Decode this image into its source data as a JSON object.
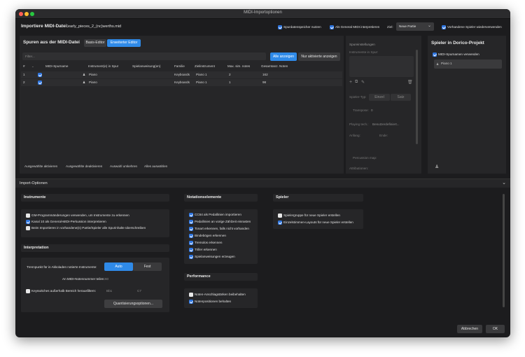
{
  "window": {
    "title": "MIDI-Importoptionen"
  },
  "top": {
    "file_label": "Importiere MIDI-Datei:",
    "file_name": "early_pieces_2_(nc)werths.mid",
    "opt_save_tracks": "Spurdatenspeicher nutzen",
    "opt_gm": "Als General MIDI interpretieren",
    "target_label": "Ziel:",
    "target_value": "Neue Partie",
    "opt_reuse_players": "Vorhandene Spieler wiederverwenden"
  },
  "tracks": {
    "title": "Spuren aus der MIDI-Datei",
    "mode_basic": "Basis-Editor",
    "mode_advanced": "Erweiterter Editor",
    "filter_placeholder": "Filter...",
    "show_all": "Alle anzeigen",
    "show_active": "Nur aktivierte anzeigen",
    "columns": [
      "#",
      "MIDI-Spurname",
      "Instrument(e) in Spur",
      "Spielanweisung(en)",
      "Familie",
      "Zielinstrument",
      "Max. sim. notes",
      "Gesamtanz. Noten"
    ],
    "rows": [
      {
        "num": "1",
        "instrument": "Piano",
        "family": "Keyboards",
        "target": "Piano 1",
        "max": "2",
        "total": "162"
      },
      {
        "num": "2",
        "instrument": "Piano",
        "family": "Keyboards",
        "target": "Piano 1",
        "max": "1",
        "total": "98"
      }
    ],
    "actions": [
      "Ausgewählte aktivieren",
      "Ausgewählte deaktivieren",
      "Auswahl umkehren",
      "Alles auswählen"
    ]
  },
  "track_settings": {
    "title": "Spureinstellungen",
    "instruments_label": "Instrumente in Spur:",
    "player_type_label": "Spieler-Typ:",
    "player_solo": "Einzel",
    "player_section": "Satz",
    "transpose_label": "Transpose:",
    "transpose_value": "0",
    "playing_tech_label": "Playing tech.:",
    "playing_tech_value": "Benutzerdefiniert...",
    "start_label": "Anfang:",
    "end_label": "Ende:",
    "percussion_label": "Percussion map:",
    "attributes_label": "Attributionen:"
  },
  "players": {
    "title": "Spieler in Dorico-Projekt",
    "use_midi_names": "MIDI-Spurnamen verwenden",
    "player_item": "Piano 1"
  },
  "import_options": {
    "title": "Import-Optionen",
    "instruments": {
      "title": "Instrumente",
      "items": [
        {
          "label": "GM-Programmänderungen verwenden, um Instrumente zu erkennen",
          "checked": false
        },
        {
          "label": "Kanal 10 als General-MIDI-Perkussion interpretieren",
          "checked": true
        },
        {
          "label": "Beim Importieren in vorhandene(n) Partie/Spieler alle Spurinhalte überschreiben",
          "checked": false
        }
      ]
    },
    "interpretation": {
      "title": "Interpretation",
      "split_label": "Trennpunkt für in Akkoladen notierte Instrumente:",
      "split_auto": "Auto",
      "split_fixed": "Fest",
      "midi_note_label": "An MIDI-Notennummer teilen:",
      "midi_note_value": "60",
      "keyswitch_label": "Keyswitches außerhalb Bereich herausfiltern:",
      "keyswitch_low": "Bb1",
      "keyswitch_high": "C7",
      "quantize_button": "Quantisierungsoptionen..."
    },
    "notation": {
      "title": "Notationselemente",
      "items": [
        {
          "label": "CC64 als Pedallinien importieren",
          "checked": true
        },
        {
          "label": "Pedallinien an vorige Zählzeit einrasten",
          "checked": true
        },
        {
          "label": "Tonart erkennen, falls nicht vorhanden",
          "checked": true
        },
        {
          "label": "Bindebögen erkennen",
          "checked": true
        },
        {
          "label": "Tremolos erkennen",
          "checked": true
        },
        {
          "label": "Triller erkennen",
          "checked": true
        },
        {
          "label": "Spielanweisungen erzeugen",
          "checked": true
        }
      ]
    },
    "performance": {
      "title": "Performance",
      "items": [
        {
          "label": "Noten-Anschlagstärken beibehalten",
          "checked": false
        },
        {
          "label": "Notenpositionen behalten",
          "checked": true
        }
      ]
    },
    "players": {
      "title": "Spieler",
      "items": [
        {
          "label": "Spielergruppe für neue Spieler erstellen",
          "checked": false
        },
        {
          "label": "Einzelstimmen-Layouts für neue Spieler erstellen",
          "checked": true
        }
      ]
    }
  },
  "footer": {
    "cancel": "Abbrechen",
    "ok": "OK"
  },
  "colors": {
    "accent": "#2f8ae8",
    "window_bg": "#1c1c1e",
    "panel_bg": "#262628"
  }
}
